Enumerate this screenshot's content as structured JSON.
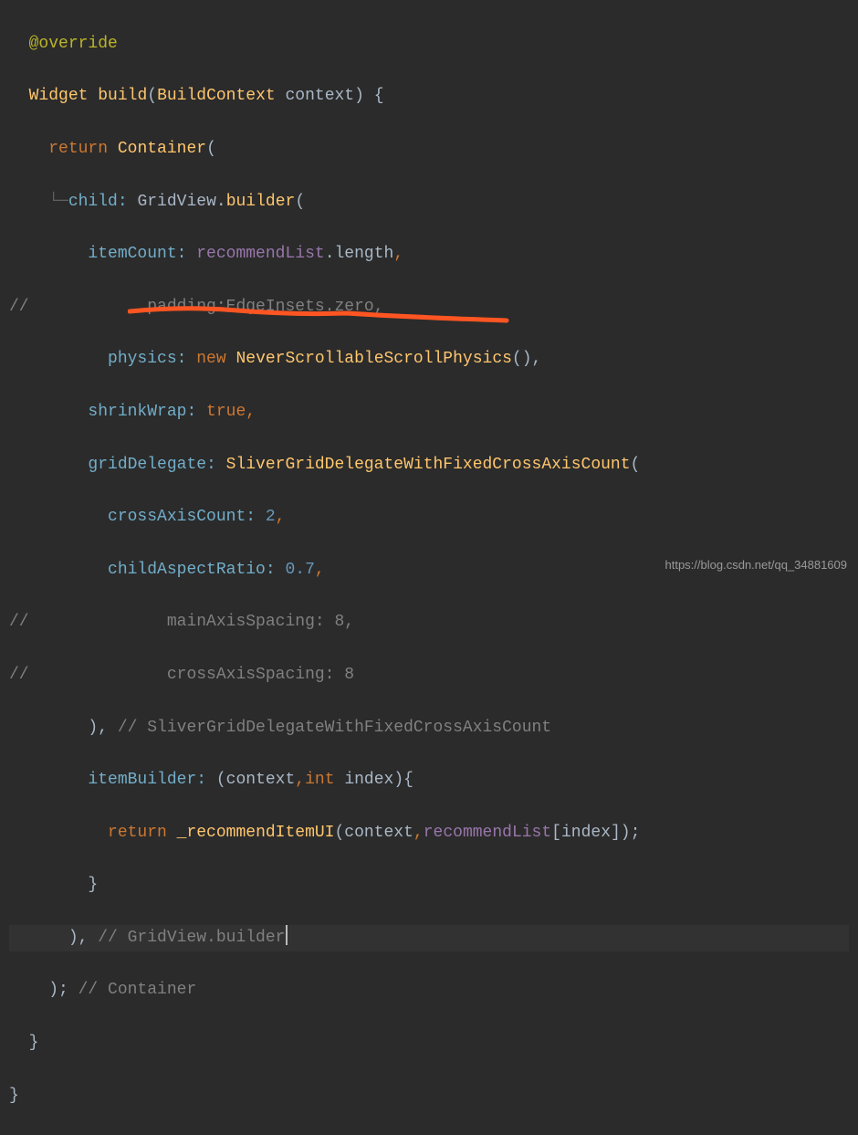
{
  "code": {
    "l1_annotation": "@override",
    "l2_widget": "Widget ",
    "l2_build": "build",
    "l2_paren_open": "(",
    "l2_buildcontext": "BuildContext ",
    "l2_context": "context",
    "l2_close": ") {",
    "l3_return": "return ",
    "l3_container": "Container",
    "l3_paren": "(",
    "l4_tree": "└─",
    "l4_child": "child: ",
    "l4_gridview": "GridView",
    "l4_dot": ".",
    "l4_builder": "builder",
    "l4_paren": "(",
    "l5_itemcount": "itemCount: ",
    "l5_recommend": "recommendList",
    "l5_length": ".length",
    "l5_comma": ",",
    "l6_comment_slash": "//",
    "l6_padding": "padding:EdgeInsets.zero,",
    "l7_physics": "physics: ",
    "l7_new": "new ",
    "l7_never": "NeverScrollableScrollPhysics",
    "l7_parens": "(),",
    "l8_shrink": "shrinkWrap: ",
    "l8_true": "true",
    "l8_comma": ",",
    "l9_griddel": "gridDelegate: ",
    "l9_sliver": "SliverGridDelegateWithFixedCrossAxisCount",
    "l9_paren": "(",
    "l10_cross": "crossAxisCount: ",
    "l10_two": "2",
    "l10_comma": ",",
    "l11_aspect": "childAspectRatio: ",
    "l11_val": "0.7",
    "l11_comma": ",",
    "l12_slash": "//",
    "l12_main": "mainAxisSpacing: 8,",
    "l13_slash": "//",
    "l13_cross": "crossAxisSpacing: 8",
    "l14_close": "), ",
    "l14_comment": "// SliverGridDelegateWithFixedCrossAxisCount",
    "l15_itembuilder": "itemBuilder: ",
    "l15_paren": "(",
    "l15_ctx": "context",
    "l15_comma": ",",
    "l15_int": "int ",
    "l15_index": "index",
    "l15_close": "){",
    "l16_return": "return ",
    "l16_rec": "_recommendItemUI",
    "l16_paren": "(",
    "l16_ctx": "context",
    "l16_comma": ",",
    "l16_reclist": "recommendList",
    "l16_bracket": "[",
    "l16_index": "index",
    "l16_closebr": "]);",
    "l17_brace": "}",
    "l18_close": "), ",
    "l18_comment": "// GridView.builder",
    "l19_close": "); ",
    "l19_comment": "// Container",
    "l20_brace": "}",
    "l21_brace": "}"
  },
  "watermark": "https://blog.csdn.net/qq_34881609"
}
